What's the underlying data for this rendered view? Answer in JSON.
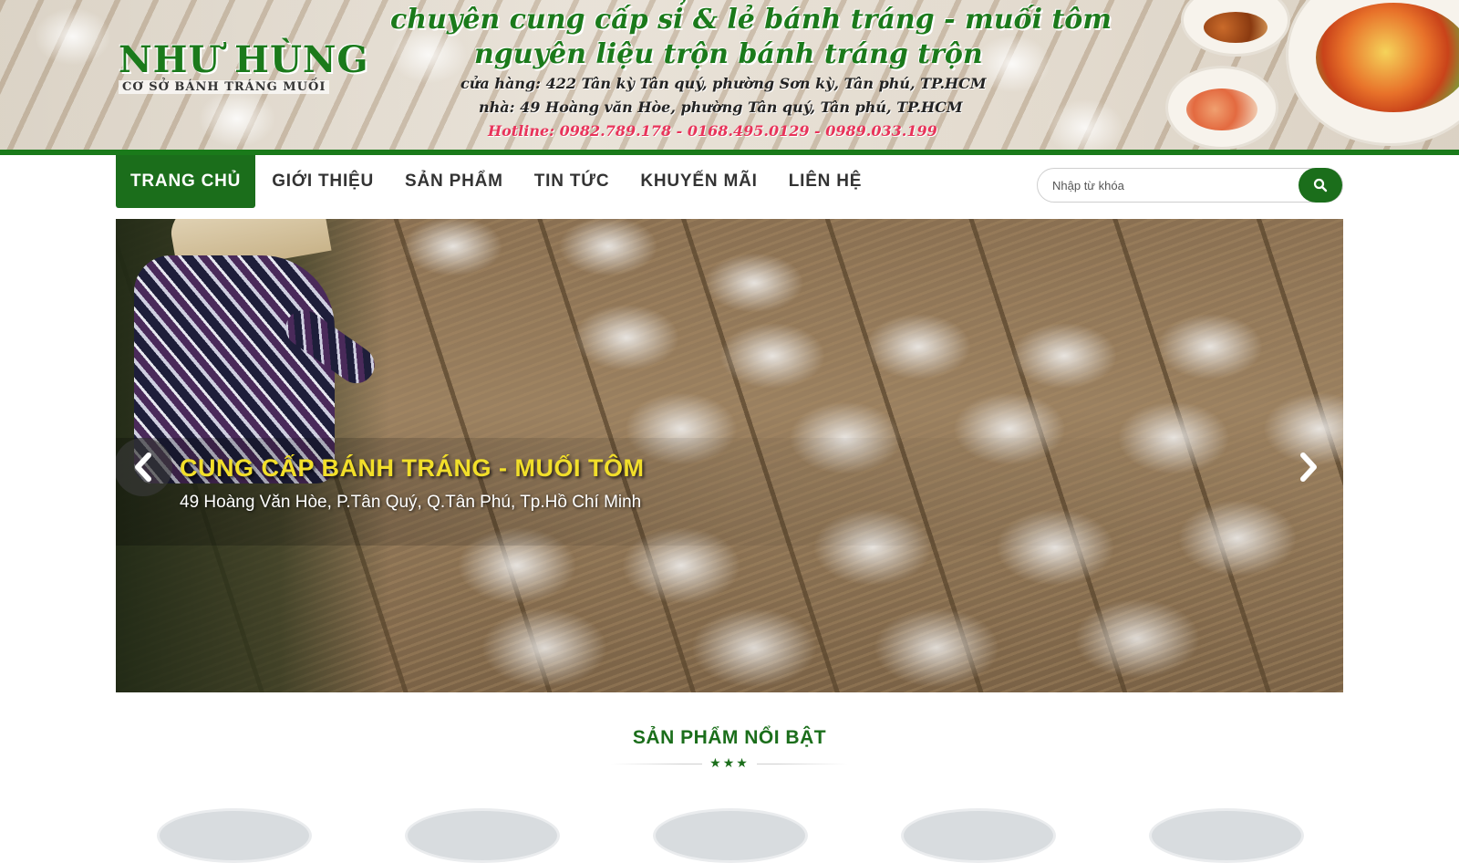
{
  "banner": {
    "logo_title": "NHƯ HÙNG",
    "logo_subtitle": "CƠ SỞ BÁNH TRÁNG MUỐI",
    "tagline_1": "chuyên cung cấp sỉ & lẻ bánh tráng - muối tôm",
    "tagline_2": "nguyên liệu trộn bánh tráng trộn",
    "address_shop": "cửa hàng: 422 Tân kỳ Tân quý, phường Sơn kỳ, Tân phú, TP.HCM",
    "address_home": "nhà: 49 Hoàng văn Hòe, phường Tân quý, Tân phú, TP.HCM",
    "hotline": "Hotline: 0982.789.178 - 0168.495.0129 - 0989.033.199"
  },
  "nav": {
    "items": [
      "TRANG CHỦ",
      "GIỚI THIỆU",
      "SẢN PHẨM",
      "TIN TỨC",
      "KHUYẾN MÃI",
      "LIÊN HỆ"
    ],
    "active_index": 0
  },
  "search": {
    "placeholder": "Nhập từ khóa",
    "value": ""
  },
  "slider": {
    "caption_title": "CUNG CẤP BÁNH TRÁNG - MUỐI TÔM",
    "caption_subtitle": "49 Hoàng Văn Hòe, P.Tân Quý, Q.Tân Phú, Tp.Hồ Chí Minh",
    "prev_icon": "chevron-left-icon",
    "next_icon": "chevron-right-icon"
  },
  "featured": {
    "title": "SẢN PHẨM NỔI BẬT",
    "stars": "★★★"
  },
  "colors": {
    "brand_green": "#1b6e1b",
    "caption_yellow": "#f2df2a",
    "hotline_pink": "#e8335a"
  }
}
